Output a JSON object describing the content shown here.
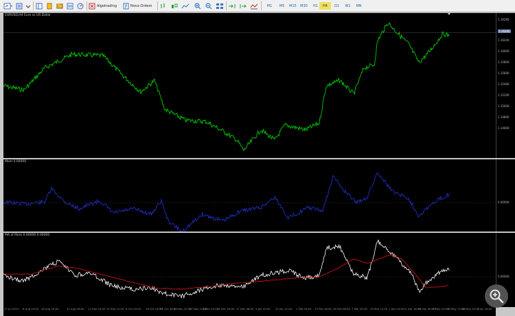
{
  "toolbar": {
    "algo_label": "Algotrading",
    "new_order_label": "Nova Ordem",
    "timeframes": [
      "M1",
      "M5",
      "M15",
      "M30",
      "H1",
      "H4",
      "D1",
      "W1",
      "MN"
    ],
    "active_timeframe": "H4"
  },
  "chart": {
    "symbol_title": "EURUSD,H4  Euro vs US Dollar",
    "price_labels": [
      "1.16285",
      "1.16200",
      "1.16000",
      "1.15800",
      "1.15600",
      "1.15400",
      "1.15200",
      "1.15000",
      "1.14800",
      "1.14600"
    ],
    "current_price": "1.16285",
    "grid": false,
    "colors": {
      "price": "#00cc00",
      "momentum": "#2030c0",
      "ma_momentum_white": "#ffffff",
      "ma_momentum_red": "#d01010",
      "background": "#000000"
    }
  },
  "indicator1": {
    "label": "Mom 0.00000",
    "axis_labels": [
      "0.00000"
    ]
  },
  "indicator2": {
    "label": "MA of Mom 0.00000 0.00000",
    "axis_labels": [
      "0.00000"
    ]
  },
  "x_axis": {
    "labels": [
      "27 Jul 2023",
      "8 Aug 04:00",
      "18 Aug 16:00",
      "31 Aug 08:00",
      "12 Sep 20:00",
      "25 Sep 12:00",
      "6 Oct 04:00",
      "18 Oct 16:00",
      "31 Oct 08:00",
      "10 Nov 20:00",
      "22 Nov 12:00",
      "4 Dec 04:00",
      "14 Dec 16:00",
      "27 Dec 08:00",
      "9 Jan 20:00",
      "22 Jan 12:00",
      "1 Feb 04:00",
      "13 Feb 16:00",
      "26 Feb 08:00",
      "7 Mar 20:00",
      "20 Mar 12:00",
      "1 Apr 04:00",
      "11 Apr 16:00",
      "24 Apr 08:00",
      "3 May 20:00",
      "16 May 12:00",
      "28 May 04:00",
      "7 Jun 16:00"
    ]
  }
}
